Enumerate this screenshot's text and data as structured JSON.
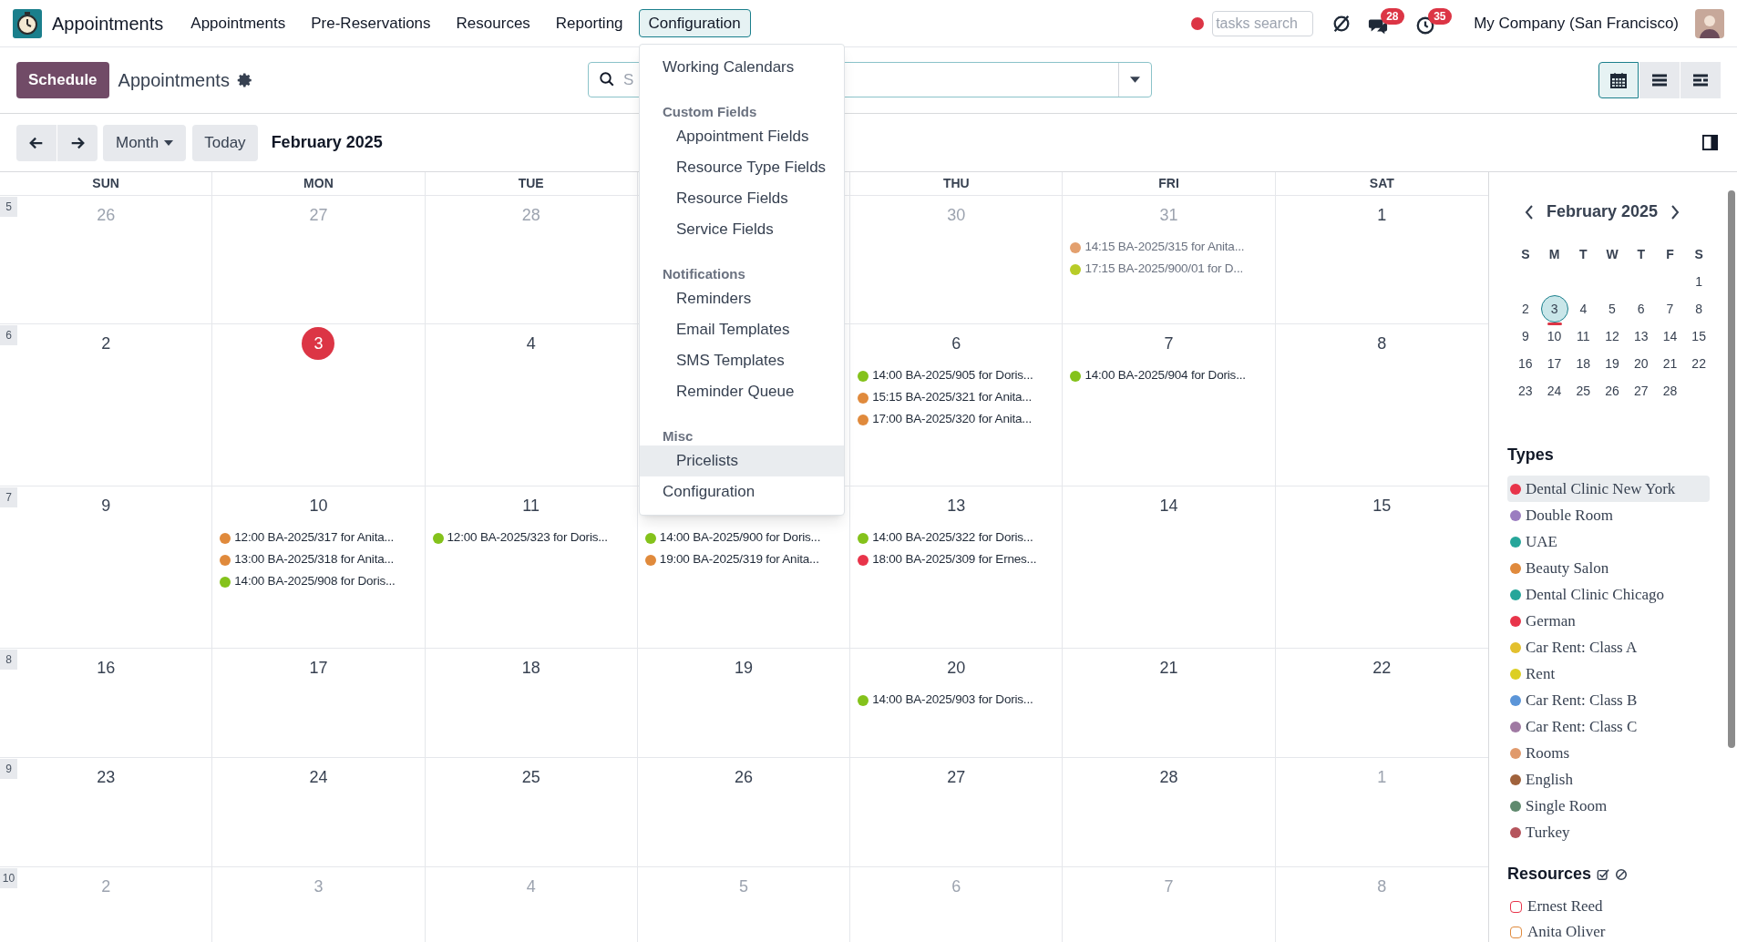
{
  "navbar": {
    "app_name": "Appointments",
    "menu": [
      {
        "label": "Appointments",
        "selected": false
      },
      {
        "label": "Pre-Reservations",
        "selected": false
      },
      {
        "label": "Resources",
        "selected": false
      },
      {
        "label": "Reporting",
        "selected": false
      },
      {
        "label": "Configuration",
        "selected": true
      }
    ],
    "tasks_search": {
      "placeholder": "tasks search"
    },
    "messages_badge": "28",
    "activities_badge": "35",
    "company": "My Company (San Francisco)"
  },
  "control_panel": {
    "new_button": "Schedule",
    "title": "Appointments",
    "search": {
      "placeholder": "S"
    },
    "views": [
      {
        "kind": "calendar",
        "selected": true
      },
      {
        "kind": "list",
        "selected": false
      },
      {
        "kind": "gantt",
        "selected": false
      }
    ],
    "scale_button": "Month",
    "today_button": "Today",
    "period": "February 2025"
  },
  "config_menu": [
    {
      "kind": "item",
      "label": "Working Calendars",
      "highlighted": false
    },
    {
      "kind": "header",
      "label": "Custom Fields"
    },
    {
      "kind": "subitem",
      "label": "Appointment Fields",
      "highlighted": false
    },
    {
      "kind": "subitem",
      "label": "Resource Type Fields",
      "highlighted": false
    },
    {
      "kind": "subitem",
      "label": "Resource Fields",
      "highlighted": false
    },
    {
      "kind": "subitem",
      "label": "Service Fields",
      "highlighted": false
    },
    {
      "kind": "header",
      "label": "Notifications"
    },
    {
      "kind": "subitem",
      "label": "Reminders",
      "highlighted": false
    },
    {
      "kind": "subitem",
      "label": "Email Templates",
      "highlighted": false
    },
    {
      "kind": "subitem",
      "label": "SMS Templates",
      "highlighted": false
    },
    {
      "kind": "subitem",
      "label": "Reminder Queue",
      "highlighted": false
    },
    {
      "kind": "header",
      "label": "Misc"
    },
    {
      "kind": "subitem",
      "label": "Pricelists",
      "highlighted": true
    },
    {
      "kind": "item",
      "label": "Configuration",
      "highlighted": false
    }
  ],
  "calendar": {
    "day_headers": [
      {
        "kind": "label",
        "label": "SUN"
      },
      {
        "kind": "label",
        "label": "MON"
      },
      {
        "kind": "label",
        "label": "TUE"
      },
      {
        "kind": "covered"
      },
      {
        "kind": "label",
        "label": "THU"
      },
      {
        "kind": "label",
        "label": "FRI"
      },
      {
        "kind": "label",
        "label": "SAT"
      }
    ],
    "weeks": [
      {
        "week": "5",
        "days": [
          {
            "kind": "day",
            "date": "26",
            "muted": true
          },
          {
            "kind": "day",
            "date": "27",
            "muted": true
          },
          {
            "kind": "day",
            "date": "28",
            "muted": true
          },
          {
            "kind": "covered"
          },
          {
            "kind": "day",
            "date": "30",
            "muted": true
          },
          {
            "kind": "day",
            "date": "31",
            "muted": true,
            "events": [
              {
                "text": "14:15 BA-2025/315 for Anita...",
                "color": "#e3a06e",
                "muted": true
              },
              {
                "text": "17:15 BA-2025/900/01 for D...",
                "color": "#b8cc28",
                "muted": true
              }
            ]
          },
          {
            "kind": "day",
            "date": "1",
            "muted": false
          }
        ]
      },
      {
        "week": "6",
        "days": [
          {
            "kind": "day",
            "date": "2",
            "muted": false
          },
          {
            "kind": "day",
            "date": "3",
            "muted": false,
            "today": true
          },
          {
            "kind": "day",
            "date": "4",
            "muted": false
          },
          {
            "kind": "covered"
          },
          {
            "kind": "day",
            "date": "6",
            "muted": false,
            "events": [
              {
                "text": "14:00 BA-2025/905 for Doris...",
                "color": "#84c21b",
                "muted": false
              },
              {
                "text": "15:15 BA-2025/321 for Anita...",
                "color": "#e08a3c",
                "muted": false
              },
              {
                "text": "17:00 BA-2025/320 for Anita...",
                "color": "#e08a3c",
                "muted": false
              }
            ]
          },
          {
            "kind": "day",
            "date": "7",
            "muted": false,
            "events": [
              {
                "text": "14:00 BA-2025/904 for Doris...",
                "color": "#84c21b",
                "muted": false
              }
            ]
          },
          {
            "kind": "day",
            "date": "8",
            "muted": false
          }
        ]
      },
      {
        "week": "7",
        "days": [
          {
            "kind": "day",
            "date": "9",
            "muted": false
          },
          {
            "kind": "day",
            "date": "10",
            "muted": false,
            "events": [
              {
                "text": "12:00 BA-2025/317 for Anita...",
                "color": "#e08a3c",
                "muted": false
              },
              {
                "text": "13:00 BA-2025/318 for Anita...",
                "color": "#e08a3c",
                "muted": false
              },
              {
                "text": "14:00 BA-2025/908 for Doris...",
                "color": "#84c21b",
                "muted": false
              }
            ]
          },
          {
            "kind": "day",
            "date": "11",
            "muted": false,
            "events": [
              {
                "text": "12:00 BA-2025/323 for Doris...",
                "color": "#84c21b",
                "muted": false
              }
            ]
          },
          {
            "kind": "day",
            "events": [
              {
                "text": "14:00 BA-2025/900 for Doris...",
                "color": "#84c21b",
                "muted": false
              },
              {
                "text": "19:00 BA-2025/319 for Anita...",
                "color": "#e08a3c",
                "muted": false
              }
            ]
          },
          {
            "kind": "day",
            "date": "13",
            "muted": false,
            "events": [
              {
                "text": "14:00 BA-2025/322 for Doris...",
                "color": "#84c21b",
                "muted": false
              },
              {
                "text": "18:00 BA-2025/309 for Ernes...",
                "color": "#e8344a",
                "muted": false
              }
            ]
          },
          {
            "kind": "day",
            "date": "14",
            "muted": false
          },
          {
            "kind": "day",
            "date": "15",
            "muted": false
          }
        ]
      },
      {
        "week": "8",
        "days": [
          {
            "kind": "day",
            "date": "16",
            "muted": false
          },
          {
            "kind": "day",
            "date": "17",
            "muted": false
          },
          {
            "kind": "day",
            "date": "18",
            "muted": false
          },
          {
            "kind": "day",
            "date": "19",
            "muted": false
          },
          {
            "kind": "day",
            "date": "20",
            "muted": false,
            "events": [
              {
                "text": "14:00 BA-2025/903 for Doris...",
                "color": "#84c21b",
                "muted": false
              }
            ]
          },
          {
            "kind": "day",
            "date": "21",
            "muted": false
          },
          {
            "kind": "day",
            "date": "22",
            "muted": false
          }
        ]
      },
      {
        "week": "9",
        "days": [
          {
            "kind": "day",
            "date": "23",
            "muted": false
          },
          {
            "kind": "day",
            "date": "24",
            "muted": false
          },
          {
            "kind": "day",
            "date": "25",
            "muted": false
          },
          {
            "kind": "day",
            "date": "26",
            "muted": false
          },
          {
            "kind": "day",
            "date": "27",
            "muted": false
          },
          {
            "kind": "day",
            "date": "28",
            "muted": false
          },
          {
            "kind": "day",
            "date": "1",
            "muted": true
          }
        ]
      },
      {
        "week": "10",
        "days": [
          {
            "kind": "day",
            "date": "2",
            "muted": true
          },
          {
            "kind": "day",
            "date": "3",
            "muted": true
          },
          {
            "kind": "day",
            "date": "4",
            "muted": true
          },
          {
            "kind": "day",
            "date": "5",
            "muted": true
          },
          {
            "kind": "day",
            "date": "6",
            "muted": true
          },
          {
            "kind": "day",
            "date": "7",
            "muted": true
          },
          {
            "kind": "day",
            "date": "8",
            "muted": true
          }
        ]
      }
    ]
  },
  "sidebar": {
    "mini_calendar": {
      "title": "February 2025",
      "weekdays": [
        "S",
        "M",
        "T",
        "W",
        "T",
        "F",
        "S"
      ],
      "weeks": [
        [
          "1"
        ],
        [
          "2",
          {
            "label": "3",
            "today": true
          },
          "4",
          "5",
          "6",
          "7",
          "8"
        ],
        [
          "9",
          "10",
          "11",
          "12",
          "13",
          "14",
          "15"
        ],
        [
          "16",
          "17",
          "18",
          "19",
          "20",
          "21",
          "22"
        ],
        [
          "23",
          "24",
          "25",
          "26",
          "27",
          "28"
        ]
      ]
    },
    "types_title": "Types",
    "types": [
      {
        "label": "Dental Clinic New York",
        "color": "#e8344a",
        "selected": true
      },
      {
        "label": "Double Room",
        "color": "#9b7dc0",
        "selected": false
      },
      {
        "label": "UAE",
        "color": "#26a69a",
        "selected": false
      },
      {
        "label": "Beauty Salon",
        "color": "#e08a3c",
        "selected": false
      },
      {
        "label": "Dental Clinic Chicago",
        "color": "#26a69a",
        "selected": false
      },
      {
        "label": "German",
        "color": "#e8344a",
        "selected": false
      },
      {
        "label": "Car Rent: Class A",
        "color": "#e3c02e",
        "selected": false
      },
      {
        "label": "Rent",
        "color": "#dccf22",
        "selected": false
      },
      {
        "label": "Car Rent: Class B",
        "color": "#5b95d8",
        "selected": false
      },
      {
        "label": "Car Rent: Class C",
        "color": "#a07aa3",
        "selected": false
      },
      {
        "label": "Rooms",
        "color": "#e09a6c",
        "selected": false
      },
      {
        "label": "English",
        "color": "#a0623c",
        "selected": false
      },
      {
        "label": "Single Room",
        "color": "#5f8a6e",
        "selected": false
      },
      {
        "label": "Turkey",
        "color": "#b5545c",
        "selected": false
      }
    ],
    "resources_title": "Resources",
    "resources": [
      {
        "label": "Ernest Reed",
        "color": "#e8344a",
        "checked": false
      },
      {
        "label": "Anita Oliver",
        "color": "#e08a3c",
        "checked": false
      }
    ]
  }
}
